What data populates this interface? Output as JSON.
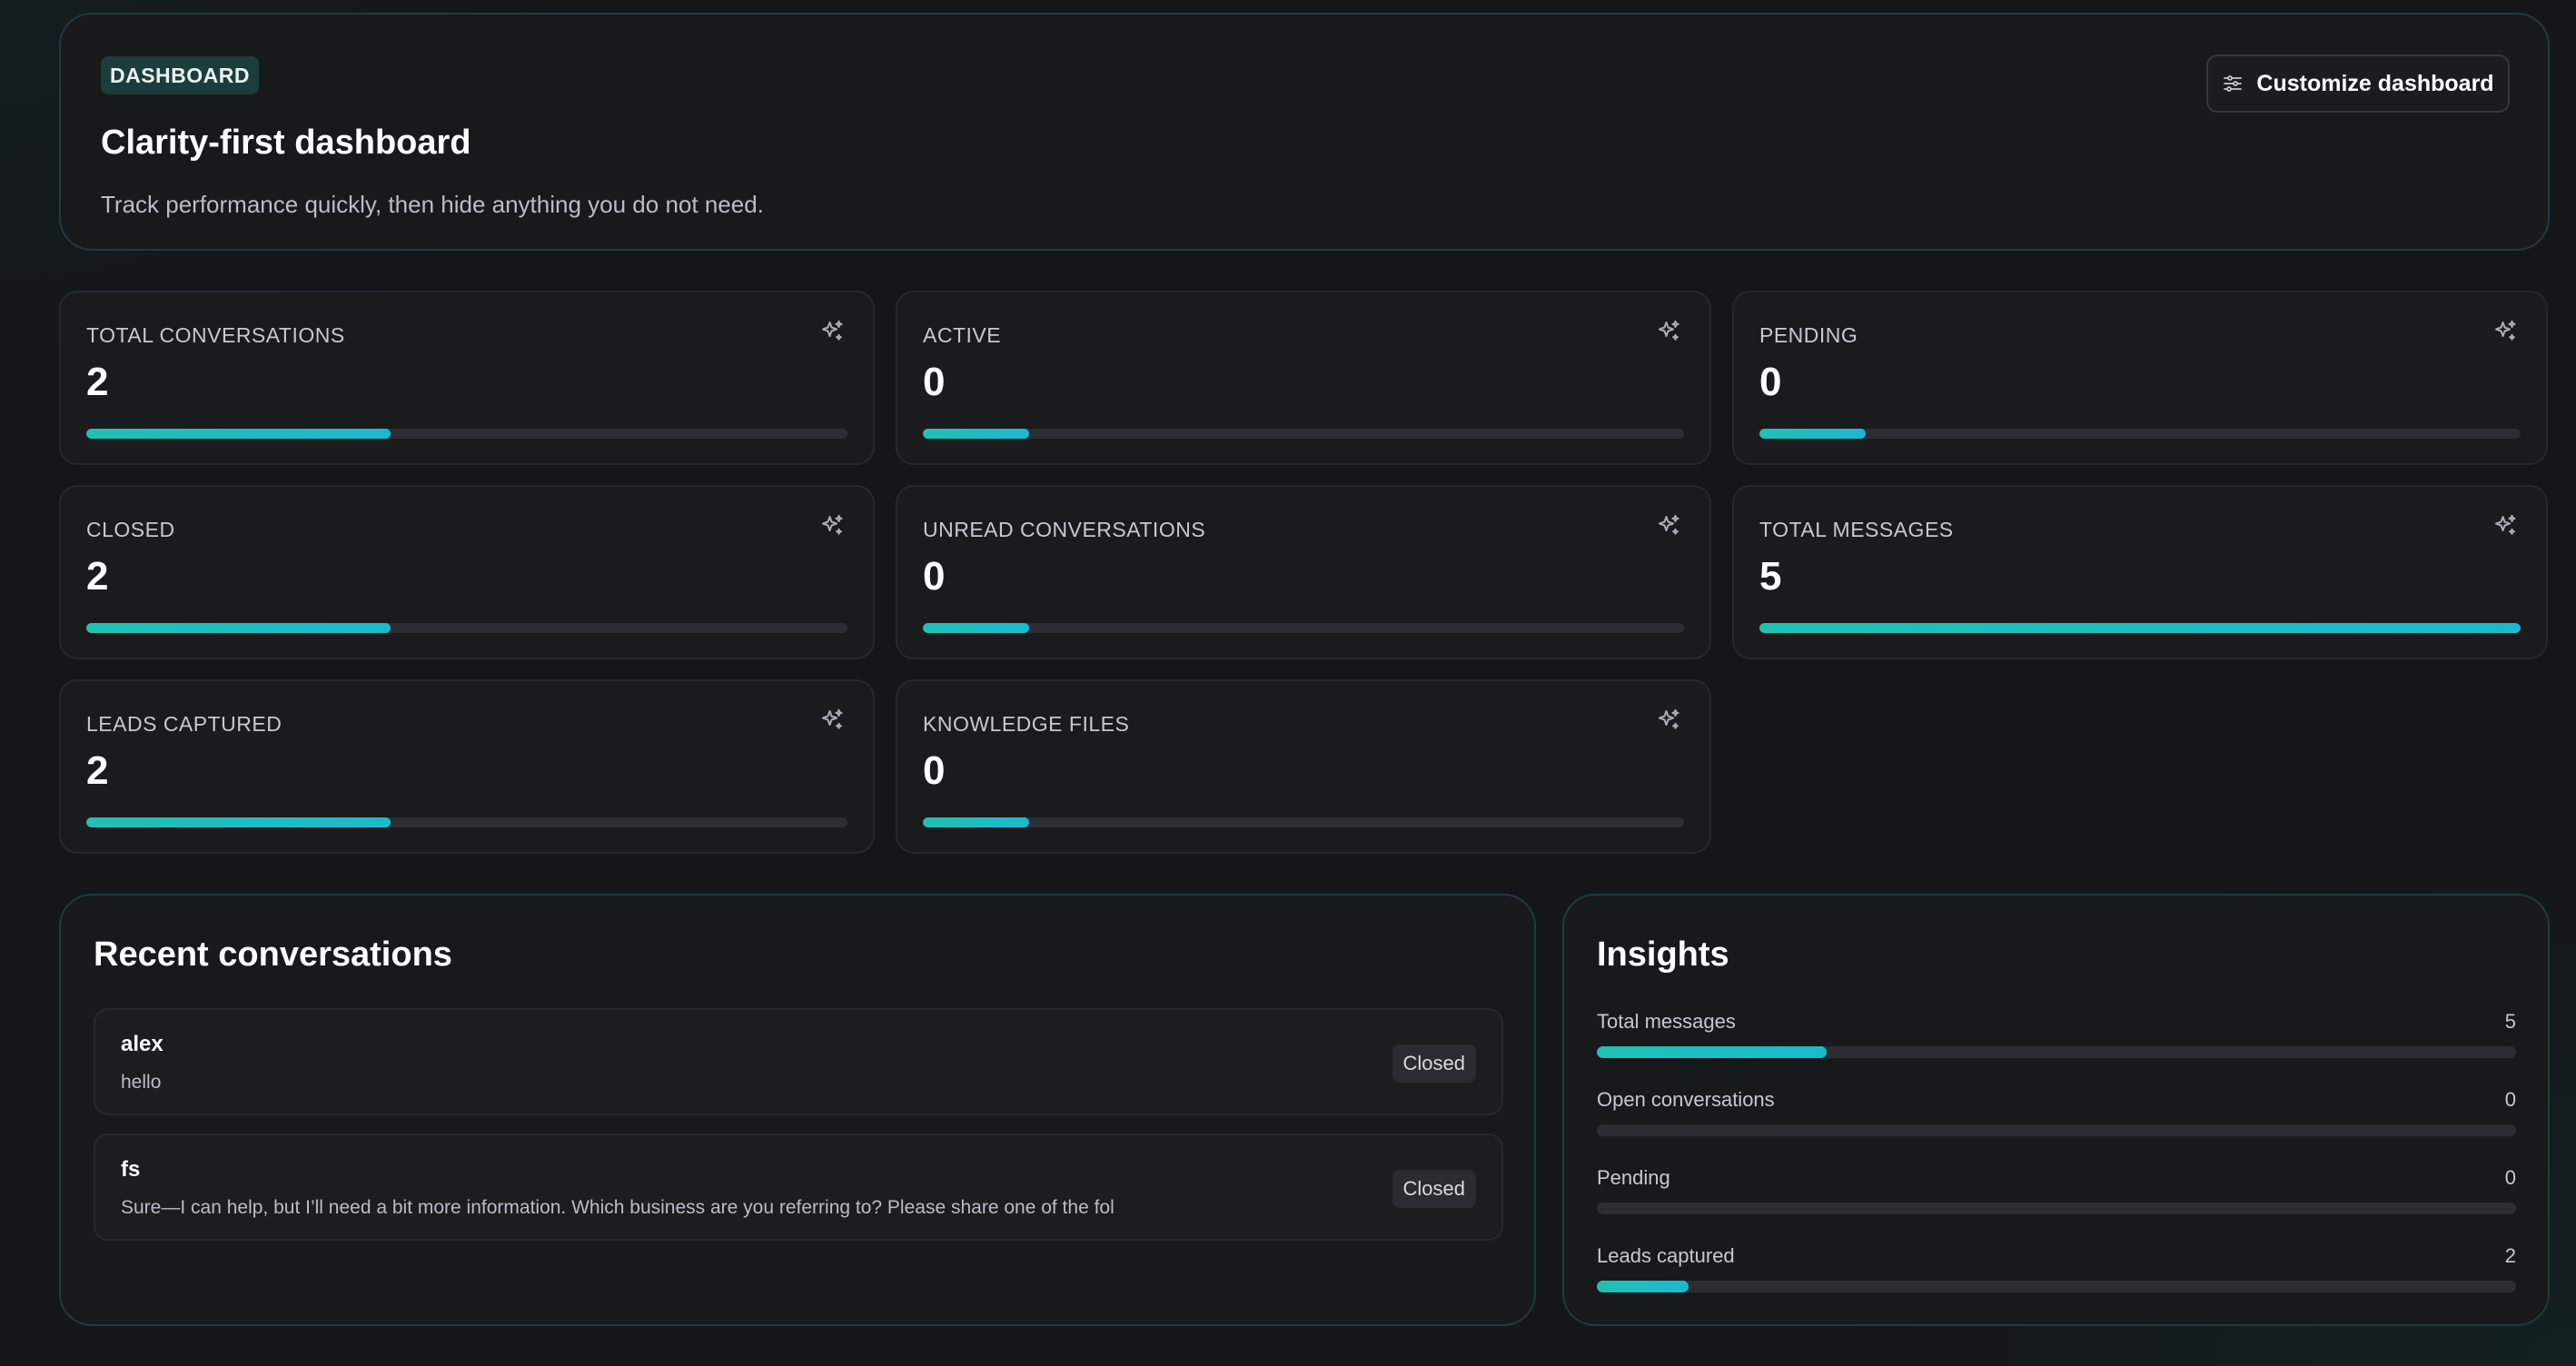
{
  "hero": {
    "badge": "DASHBOARD",
    "title": "Clarity-first dashboard",
    "subtitle": "Track performance quickly, then hide anything you do not need.",
    "customize_label": "Customize dashboard",
    "customize_icon": "sliders-icon"
  },
  "stats": [
    {
      "label": "TOTAL CONVERSATIONS",
      "value": "2",
      "fill_fraction": 0.4,
      "icon": "sparkles-icon"
    },
    {
      "label": "ACTIVE",
      "value": "0",
      "fill_fraction": 0.14,
      "icon": "sparkles-icon"
    },
    {
      "label": "PENDING",
      "value": "0",
      "fill_fraction": 0.14,
      "icon": "sparkles-icon"
    },
    {
      "label": "CLOSED",
      "value": "2",
      "fill_fraction": 0.4,
      "icon": "sparkles-icon"
    },
    {
      "label": "UNREAD CONVERSATIONS",
      "value": "0",
      "fill_fraction": 0.14,
      "icon": "sparkles-icon"
    },
    {
      "label": "TOTAL MESSAGES",
      "value": "5",
      "fill_fraction": 1.0,
      "icon": "sparkles-icon"
    },
    {
      "label": "LEADS CAPTURED",
      "value": "2",
      "fill_fraction": 0.4,
      "icon": "sparkles-icon"
    },
    {
      "label": "KNOWLEDGE FILES",
      "value": "0",
      "fill_fraction": 0.14,
      "icon": "sparkles-icon"
    }
  ],
  "recent": {
    "title": "Recent conversations",
    "items": [
      {
        "name": "alex",
        "message": "hello",
        "status": "Closed"
      },
      {
        "name": "fs",
        "message": "Sure—I can help, but I’ll need a bit more information. Which business are you referring to? Please share one of the fol",
        "status": "Closed"
      }
    ]
  },
  "insights": {
    "title": "Insights",
    "rows": [
      {
        "label": "Total messages",
        "value": "5",
        "fill_fraction": 0.25
      },
      {
        "label": "Open conversations",
        "value": "0",
        "fill_fraction": 0
      },
      {
        "label": "Pending",
        "value": "0",
        "fill_fraction": 0
      },
      {
        "label": "Leads captured",
        "value": "2",
        "fill_fraction": 0.1
      }
    ]
  },
  "colors": {
    "accent": "#20c1b3",
    "accent_end": "#1cb9cf",
    "card_bg": "#1a1b1d",
    "page_bg": "#141618"
  }
}
